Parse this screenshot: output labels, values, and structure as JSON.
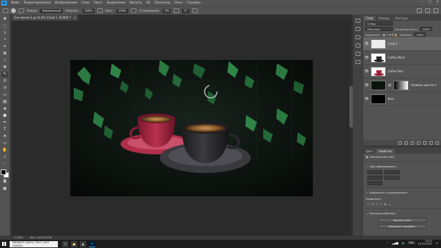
{
  "menubar": {
    "items": [
      "Файл",
      "Редактирование",
      "Изображение",
      "Слои",
      "Текст",
      "Выделение",
      "Фильтр",
      "3D",
      "Просмотр",
      "Окно",
      "Справка"
    ],
    "logo": "Ps"
  },
  "options": {
    "mode_label": "Режим:",
    "mode_value": "Нормальный",
    "opacity_label": "Непрозр.:",
    "opacity_value": "100%",
    "flow_label": "Наж.:",
    "flow_value": "100%",
    "smooth_label": "Сглаживание:",
    "smooth_value": "0%",
    "angle_value": "0°"
  },
  "document": {
    "tab_title": "Без имени-1 @ 41,6% (Слой 1, RGB/8) *",
    "close": "×"
  },
  "status": {
    "zoom": "41,68%",
    "doc": "Док: 2,64М/5,93М"
  },
  "layers_panel": {
    "tabs": [
      "Слои",
      "Каналы",
      "Контуры"
    ],
    "filter": "Q Вид",
    "blend": "Обычные",
    "opacity_label": "Непрозрачность:",
    "opacity": "100%",
    "lock_label": "Закрепить:",
    "fill_label": "Заливка:",
    "fill": "100%",
    "layers": [
      {
        "name": "Слой 1",
        "thumb": "checker",
        "selected": true
      },
      {
        "name": "Coffee Black",
        "thumb": "cup-black",
        "selected": false
      },
      {
        "name": "Coffee Red",
        "thumb": "cup-red",
        "selected": false
      },
      {
        "name": "Заливка цветом 1",
        "thumb": "plant",
        "selected": false
      },
      {
        "name": "Фон",
        "thumb": "black",
        "selected": false
      }
    ]
  },
  "properties_panel": {
    "tabs": [
      "Цвет",
      "Свойства"
    ],
    "layer_kind": "Пиксельный слой",
    "transform_label": "Трансформировать",
    "align_label": "Выровнять и распределить",
    "align_sub": "Выровнять:",
    "quick_label": "Быстрые действия",
    "remove_bg": "Удалить фон",
    "select_subject": "Выделить предмет"
  },
  "taskbar": {
    "search_placeholder": "Введите здесь текст для поиска",
    "lang": "ENG",
    "time": "13:12",
    "date": "19.05.2021"
  },
  "colors": {
    "ui_bg": "#535353",
    "pasteboard": "#2b2b2b",
    "accent": "#31a8ff",
    "cup_red": "#a2213c",
    "cup_black": "#2a2a2e"
  }
}
